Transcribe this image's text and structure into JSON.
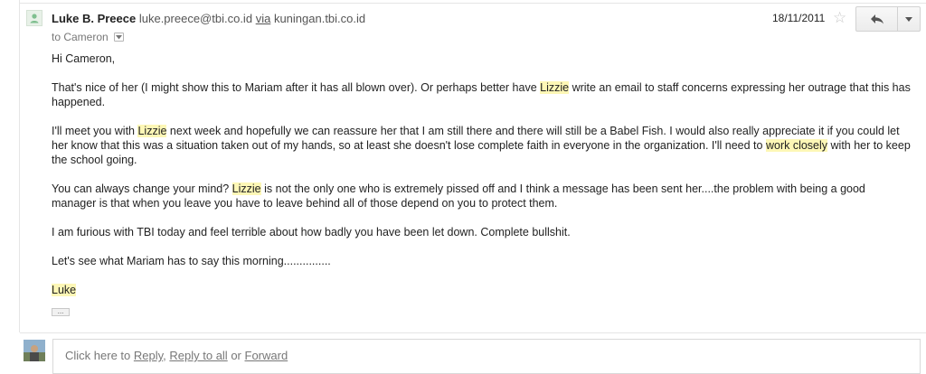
{
  "header": {
    "sender_name": "Luke B. Preece",
    "sender_email": "luke.preece@tbi.co.id",
    "via_label": "via",
    "via_domain": "kuningan.tbi.co.id",
    "to_text": "to Cameron",
    "date": "18/11/2011"
  },
  "icons": {
    "avatar": "person-icon",
    "star": "star-outline-icon",
    "reply": "reply-arrow-icon",
    "more": "chevron-down-icon",
    "to_details": "caret-down-icon"
  },
  "colors": {
    "highlight": "#fdf7b6",
    "link": "#555555"
  },
  "body": {
    "greeting": "Hi Cameron,",
    "p1": {
      "a": "That's nice of her (I might show this to Mariam after it has all blown over). Or perhaps better have ",
      "hl1": "Lizzie",
      "b": " write an email to staff concerns expressing her outrage that this has happened."
    },
    "p2": {
      "a": "I'll meet you with ",
      "hl1": "Lizzie",
      "b": " next week and hopefully we can reassure her that I am still there and there will still be a Babel Fish. I would also really appreciate it if you could let her know that this was a situation taken out of my hands, so at least she doesn't lose complete faith in everyone in the organization. I'll need to ",
      "hl2": "work closely",
      "c": " with her to keep the school going."
    },
    "p3": {
      "a": "You can always change your mind? ",
      "hl1": "Lizzie",
      "b": " is not the only one who is extremely pissed off and I think a message has been sent her....the problem with being a good manager is that when you leave you have to leave behind all of those depend on you to protect them."
    },
    "p4": "I am furious with TBI today and feel terrible about how badly you have been let down. Complete bullshit.",
    "p5": "Let's see what Mariam has to say this morning...............",
    "signature": "Luke"
  },
  "trimmed_content_label": "...",
  "reply_box": {
    "prefix": "Click here to ",
    "reply": "Reply",
    "sep1": ", ",
    "reply_all": "Reply to all",
    "sep2": " or ",
    "forward": "Forward"
  }
}
